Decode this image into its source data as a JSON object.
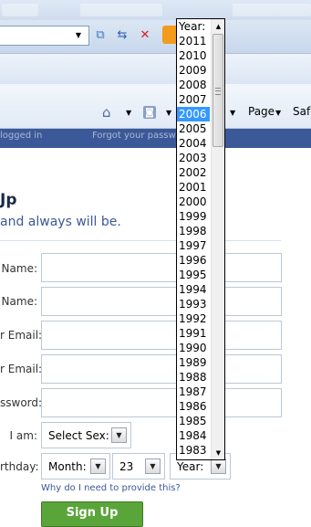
{
  "browser": {
    "command_bar": {
      "page_label": "Page",
      "safety_label": "Safe",
      "home_icon": "home-icon",
      "feeds_icon": "rss-feed-icon"
    },
    "toolbar": {
      "compat_icon": "compatibility-view-icon",
      "refresh_icon": "refresh-icon",
      "stop_icon": "stop-icon"
    }
  },
  "fb_header": {
    "keep_logged_label": "logged in",
    "forgot_label": "Forgot your passw"
  },
  "signup": {
    "heading": "Jp",
    "subheading": "and always will be.",
    "fields": [
      {
        "label": "Name:",
        "value": ""
      },
      {
        "label": "Name:",
        "value": ""
      },
      {
        "label": "r Email:",
        "value": ""
      },
      {
        "label": "r Email:",
        "value": ""
      },
      {
        "label": "ssword:",
        "value": ""
      }
    ],
    "iam_label": "I am:",
    "sex_select": "Select Sex:",
    "birthday_label": "rthday:",
    "month_select": "Month:",
    "day_select": "23",
    "year_select": "Year:",
    "why_link": "Why do I need to provide this?",
    "signup_button": "Sign Up"
  },
  "year_dropdown": {
    "options": [
      "Year:",
      "2011",
      "2010",
      "2009",
      "2008",
      "2007",
      "2006",
      "2005",
      "2004",
      "2003",
      "2002",
      "2001",
      "2000",
      "1999",
      "1998",
      "1997",
      "1996",
      "1995",
      "1994",
      "1993",
      "1992",
      "1991",
      "1990",
      "1989",
      "1988",
      "1987",
      "1986",
      "1985",
      "1984",
      "1983"
    ],
    "highlighted": "2006"
  },
  "colors": {
    "facebook_blue": "#3b5998",
    "highlight": "#3399ff",
    "signup_green": "#5aa53a"
  }
}
